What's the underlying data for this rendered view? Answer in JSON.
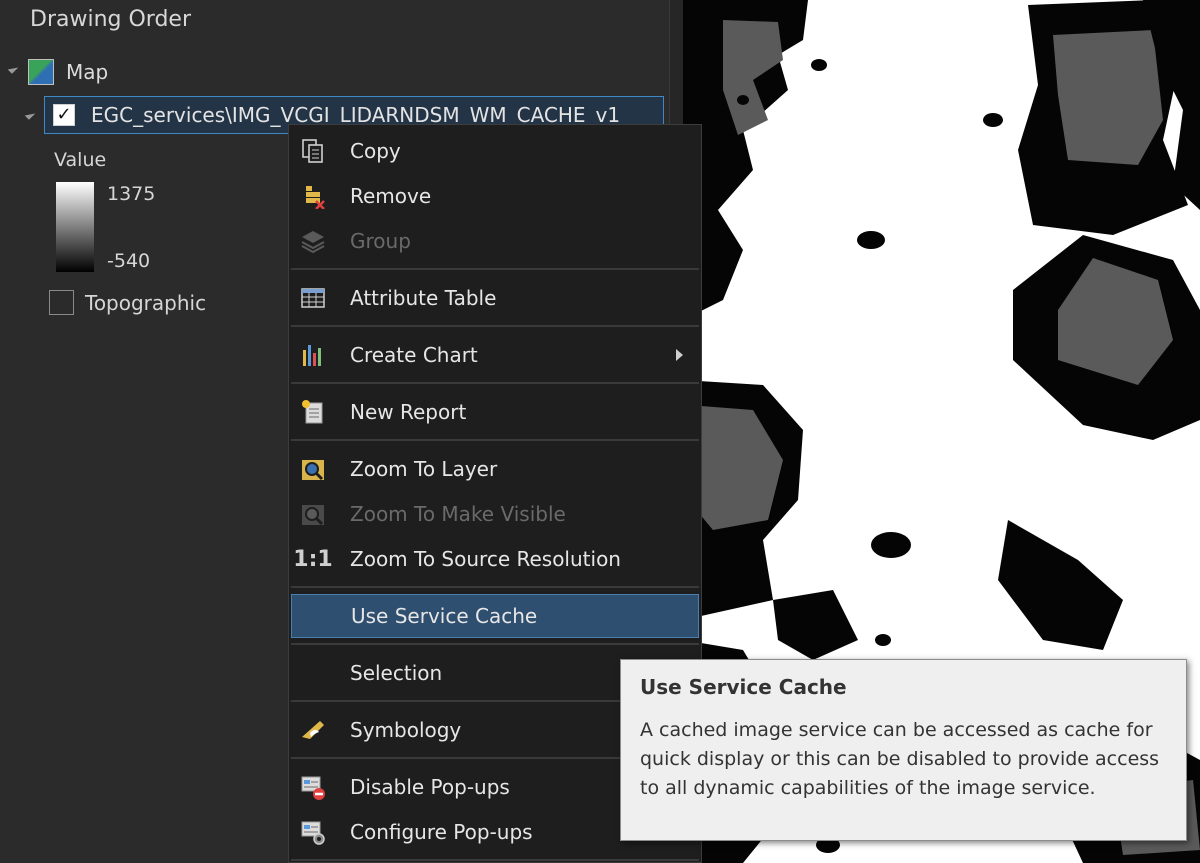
{
  "panel": {
    "title": "Drawing Order",
    "map_label": "Map",
    "layer_name": "EGC_services\\IMG_VCGI_LIDARNDSM_WM_CACHE_v1",
    "layer_checked": true,
    "legend": {
      "title": "Value",
      "max": "1375",
      "min": "-540"
    },
    "topographic_label": "Topographic",
    "topographic_checked": false
  },
  "context_menu": {
    "items": [
      {
        "label": "Copy",
        "icon": "copy-icon",
        "enabled": true
      },
      {
        "label": "Remove",
        "icon": "remove-icon",
        "enabled": true
      },
      {
        "label": "Group",
        "icon": "group-layers-icon",
        "enabled": false
      },
      {
        "label": "Attribute Table",
        "icon": "table-icon",
        "enabled": true
      },
      {
        "label": "Create Chart",
        "icon": "bar-chart-icon",
        "enabled": true,
        "submenu": true
      },
      {
        "label": "New Report",
        "icon": "report-icon",
        "enabled": true
      },
      {
        "label": "Zoom To Layer",
        "icon": "zoom-layer-icon",
        "enabled": true
      },
      {
        "label": "Zoom To Make Visible",
        "icon": "zoom-visible-icon",
        "enabled": false
      },
      {
        "label": "Zoom To Source Resolution",
        "icon": "one-to-one-icon",
        "enabled": true
      },
      {
        "label": "Use Service Cache",
        "icon": "none",
        "enabled": true,
        "highlighted": true
      },
      {
        "label": "Selection",
        "icon": "none",
        "enabled": true
      },
      {
        "label": "Symbology",
        "icon": "symbology-icon",
        "enabled": true
      },
      {
        "label": "Disable Pop-ups",
        "icon": "disable-popups-icon",
        "enabled": true
      },
      {
        "label": "Configure Pop-ups",
        "icon": "configure-popups-icon",
        "enabled": true
      }
    ]
  },
  "icons": {
    "one_to_one_text": "1:1"
  },
  "tooltip": {
    "title": "Use Service Cache",
    "body": "A cached image service can be accessed as cache for quick display or this can be disabled to provide access to all dynamic capabilities of the image service."
  },
  "colors": {
    "menu_bg": "#1e1e1e",
    "highlight": "#2f4f70",
    "panel_bg": "#2b2b2b",
    "selection_border": "#3f88c5"
  }
}
